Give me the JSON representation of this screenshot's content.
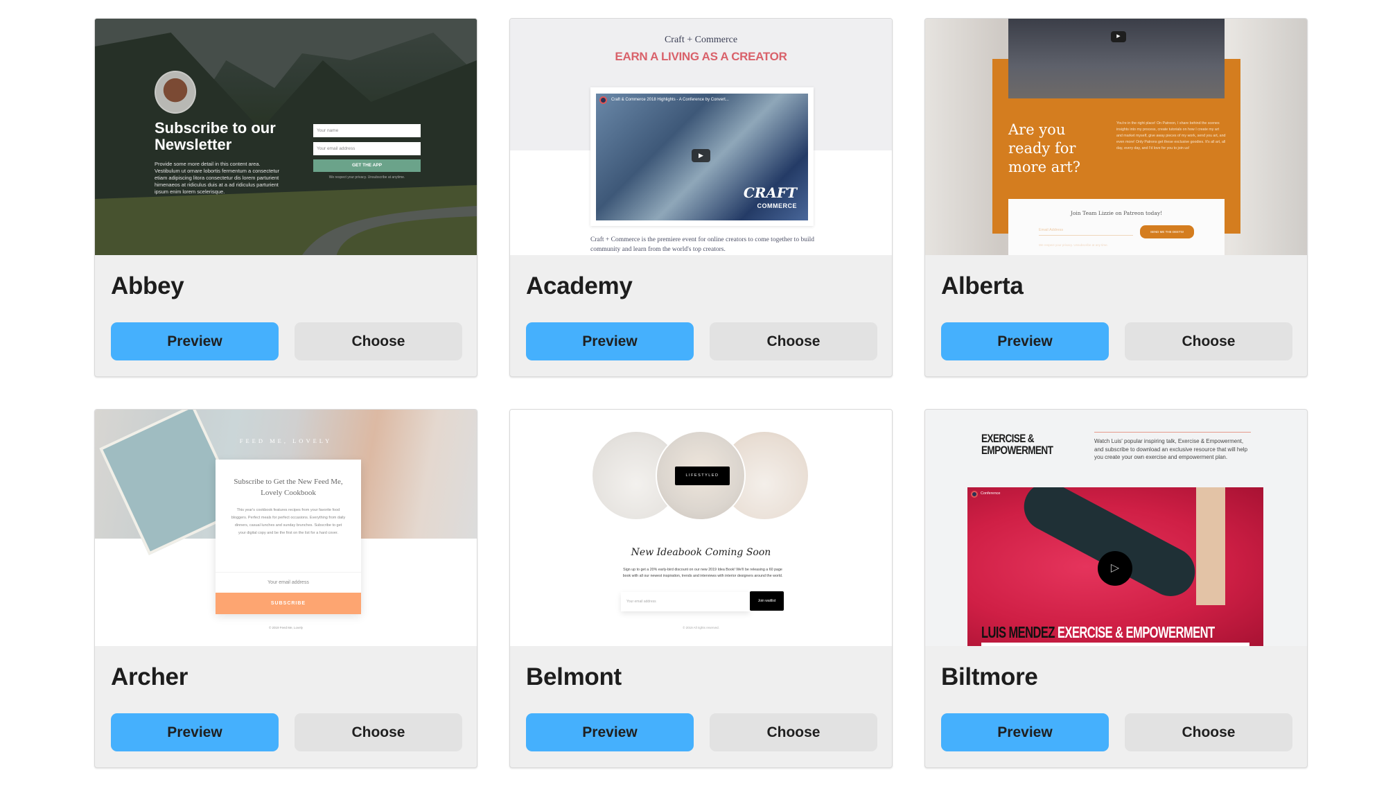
{
  "templates": [
    {
      "name": "Abbey",
      "preview_label": "Preview",
      "choose_label": "Choose",
      "thumbnail": {
        "heading": "Subscribe to our Newsletter",
        "body": "Provide some more detail in this content area. Vestibulum ut ornare lobortis fermentum a consectetur etiam adipiscing litora consectetur dis lorem parturient himenaeos at ridiculus duis at a ad ridiculus parturient ipsum enim lorem scelerisque.",
        "name_placeholder": "Your name",
        "email_placeholder": "Your email address",
        "button": "GET THE APP",
        "privacy": "We respect your privacy. Unsubscribe at anytime."
      }
    },
    {
      "name": "Academy",
      "preview_label": "Preview",
      "choose_label": "Choose",
      "thumbnail": {
        "kicker": "Craft + Commerce",
        "headline": "EARN A LIVING AS A CREATOR",
        "video_title": "Craft & Commerce 2018 Highlights - A Conference by Convert...",
        "video_brand": "CRAFT",
        "video_brand_sub": "COMMERCE",
        "body": "Craft + Commerce is the premiere event for online creators to come together to build community and learn from the world's top creators."
      }
    },
    {
      "name": "Alberta",
      "preview_label": "Preview",
      "choose_label": "Choose",
      "thumbnail": {
        "heading": "Are you ready for more art?",
        "blurb": "You're in the right place! On Patreon, I share behind the scenes insights into my process, create tutorials on how I create my art and market myself, give away pieces of my work, send you art, and even more! Only Patrons get these exclusive goodies. It's all art, all day, every day, and I'd love for you to join us!",
        "form_title": "Join Team Lizzie on Patreon today!",
        "email_placeholder": "Email Address",
        "button": "SEND ME THE DEETS!",
        "privacy": "We respect your privacy. Unsubscribe at any time."
      }
    },
    {
      "name": "Archer",
      "preview_label": "Preview",
      "choose_label": "Choose",
      "thumbnail": {
        "brand": "FEED ME, LOVELY",
        "heading": "Subscribe to Get the New Feed Me, Lovely Cookbook",
        "body": "This year's cookbook features recipes from your favorite food bloggers. Perfect meals for perfect occasions. Everything from daily dinners, casual lunches and sunday brunches. Subscribe to get your digital copy and be the first on the list for a hard cover.",
        "email_placeholder": "Your email address",
        "button": "SUBSCRIBE",
        "footer": "© 2019 Feed Me, Lovely"
      }
    },
    {
      "name": "Belmont",
      "preview_label": "Preview",
      "choose_label": "Choose",
      "thumbnail": {
        "badge": "LIFESTYLED",
        "heading": "New Ideabook Coming Soon",
        "body": "Sign up to get a 20% early-bird discount on our new 2019 Idea Book! We'll be releasing a 60 page book with all our newest inspiration, trends and interviews with interior designers around the world.",
        "email_placeholder": "Your email address",
        "button": "Join waitlist",
        "footer": "© 2019 All rights reserved."
      }
    },
    {
      "name": "Biltmore",
      "preview_label": "Preview",
      "choose_label": "Choose",
      "thumbnail": {
        "heading": "EXERCISE & EMPOWERMENT",
        "body": "Watch Luis' popular inspiring talk, Exercise & Empowerment, and subscribe to download an exclusive resource that will help you create your own exercise and empowerment plan.",
        "video_channel": "Conference",
        "banner_name": "LUIS MENDEZ",
        "banner_title": "EXERCISE & EMPOWERMENT"
      }
    }
  ],
  "colors": {
    "preview_button": "#45b0fd",
    "choose_button": "#e2e2e2",
    "card_background": "#efefef"
  }
}
